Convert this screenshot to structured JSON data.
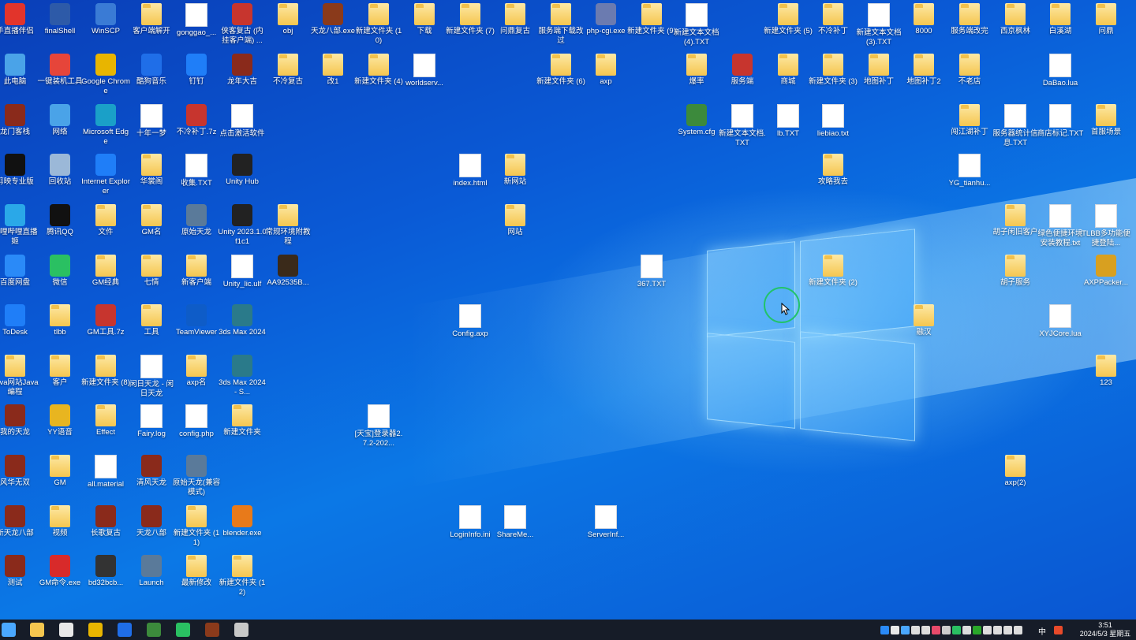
{
  "desktop": {
    "icons": [
      {
        "label": "手直播伴侣",
        "type": "app",
        "color": "#e2342b"
      },
      {
        "label": "finalShell",
        "type": "app",
        "color": "#2d5aa8"
      },
      {
        "label": "WinSCP",
        "type": "app",
        "color": "#3a7bd5"
      },
      {
        "label": "客户端解开",
        "type": "folder"
      },
      {
        "label": "gonggao_...",
        "type": "doc"
      },
      {
        "label": "侠客复古 (内挂客户端) ...",
        "type": "app",
        "color": "#c7352e"
      },
      {
        "label": "obj",
        "type": "folder"
      },
      {
        "label": "天龙八部.exe",
        "type": "app",
        "color": "#8a3a1b"
      },
      {
        "label": "新建文件夹 (10)",
        "type": "folder"
      },
      {
        "label": "下载",
        "type": "folder"
      },
      {
        "label": "新建文件夹 (7)",
        "type": "folder"
      },
      {
        "label": "问鼎复古",
        "type": "folder"
      },
      {
        "label": "服务端下载改过",
        "type": "folder"
      },
      {
        "label": "php-cgi.exe",
        "type": "app",
        "color": "#6b7bb0"
      },
      {
        "label": "新建文件夹 (9)",
        "type": "folder"
      },
      {
        "label": "新建文本文档 (4).TXT",
        "type": "doc"
      },
      {
        "label": "新建文件夹 (5)",
        "type": "folder"
      },
      {
        "label": "不冷补丁",
        "type": "folder"
      },
      {
        "label": "新建文本文档 (3).TXT",
        "type": "doc"
      },
      {
        "label": "8000",
        "type": "folder"
      },
      {
        "label": "服务端改完",
        "type": "folder"
      },
      {
        "label": "西京枫林",
        "type": "folder"
      },
      {
        "label": "白溪湖",
        "type": "folder"
      },
      {
        "label": "问鼎",
        "type": "folder"
      },
      {
        "label": "此电脑",
        "type": "app",
        "color": "#4aa3e8"
      },
      {
        "label": "一键装机工具",
        "type": "app",
        "color": "#e6453a"
      },
      {
        "label": "Google Chrome",
        "type": "app",
        "color": "#e8b500"
      },
      {
        "label": "酷狗音乐",
        "type": "app",
        "color": "#1f6ee8"
      },
      {
        "label": "钉钉",
        "type": "app",
        "color": "#1f7ef8"
      },
      {
        "label": "龙年大吉",
        "type": "app",
        "color": "#8a2a1b"
      },
      {
        "label": "不冷复古",
        "type": "folder"
      },
      {
        "label": "改1",
        "type": "folder"
      },
      {
        "label": "新建文件夹 (4)",
        "type": "folder"
      },
      {
        "label": "worldserv...",
        "type": "doc"
      },
      {
        "label": "新建文件夹 (6)",
        "type": "folder"
      },
      {
        "label": "axp",
        "type": "folder"
      },
      {
        "label": "爆率",
        "type": "folder"
      },
      {
        "label": "服务端",
        "type": "app",
        "color": "#c7352e"
      },
      {
        "label": "商城",
        "type": "folder"
      },
      {
        "label": "新建文件夹 (3)",
        "type": "folder"
      },
      {
        "label": "地图补丁",
        "type": "folder"
      },
      {
        "label": "地图补丁2",
        "type": "folder"
      },
      {
        "label": "不老店",
        "type": "folder"
      },
      {
        "label": "DaBao.lua",
        "type": "doc"
      },
      {
        "label": "龙门客栈",
        "type": "app",
        "color": "#8a2a1b"
      },
      {
        "label": "网络",
        "type": "app",
        "color": "#4aa3e8"
      },
      {
        "label": "Microsoft Edge",
        "type": "app",
        "color": "#1aa0c8"
      },
      {
        "label": "十年一梦",
        "type": "doc"
      },
      {
        "label": "不冷补丁.7z",
        "type": "app",
        "color": "#c7352e"
      },
      {
        "label": "点击激活软件",
        "type": "doc"
      },
      {
        "label": "System.cfg",
        "type": "app",
        "color": "#3c8a3c"
      },
      {
        "label": "新建文本文档.TXT",
        "type": "doc"
      },
      {
        "label": "lb.TXT",
        "type": "doc"
      },
      {
        "label": "liebiao.txt",
        "type": "doc"
      },
      {
        "label": "闯江湖补丁",
        "type": "folder"
      },
      {
        "label": "服务器统计信息.TXT",
        "type": "doc"
      },
      {
        "label": "商店标记.TXT",
        "type": "doc"
      },
      {
        "label": "首服场景",
        "type": "folder"
      },
      {
        "label": "剪映专业版",
        "type": "app",
        "color": "#111111"
      },
      {
        "label": "回收站",
        "type": "app",
        "color": "#9bb8d8"
      },
      {
        "label": "Internet Explorer",
        "type": "app",
        "color": "#1f7ef8"
      },
      {
        "label": "华裳阁",
        "type": "folder"
      },
      {
        "label": "收集.TXT",
        "type": "doc"
      },
      {
        "label": "Unity Hub",
        "type": "app",
        "color": "#222222"
      },
      {
        "label": "index.html",
        "type": "doc"
      },
      {
        "label": "新网站",
        "type": "folder"
      },
      {
        "label": "攻略我去",
        "type": "folder"
      },
      {
        "label": "YG_tianhu...",
        "type": "doc"
      },
      {
        "label": "哔哩哔哩直播姬",
        "type": "app",
        "color": "#2aa8e8"
      },
      {
        "label": "腾讯QQ",
        "type": "app",
        "color": "#111111"
      },
      {
        "label": "文件",
        "type": "folder"
      },
      {
        "label": "GM名",
        "type": "folder"
      },
      {
        "label": "原始天龙",
        "type": "app",
        "color": "#5a7a9a"
      },
      {
        "label": "Unity 2023.1.0f1c1",
        "type": "app",
        "color": "#222222"
      },
      {
        "label": "常规环境附教程",
        "type": "folder"
      },
      {
        "label": "网站",
        "type": "folder"
      },
      {
        "label": "胡子闲旧客户",
        "type": "folder"
      },
      {
        "label": "绿色便捷环境安装教程.txt",
        "type": "doc"
      },
      {
        "label": "TLBB多功能便捷登陆...",
        "type": "doc"
      },
      {
        "label": "百度网盘",
        "type": "app",
        "color": "#2a8af8"
      },
      {
        "label": "微信",
        "type": "app",
        "color": "#2ac062"
      },
      {
        "label": "GM经典",
        "type": "folder"
      },
      {
        "label": "七情",
        "type": "folder"
      },
      {
        "label": "新客户端",
        "type": "folder"
      },
      {
        "label": "Unity_lic.ulf",
        "type": "doc"
      },
      {
        "label": "AA92535B...",
        "type": "app",
        "color": "#3a2a1a"
      },
      {
        "label": "367.TXT",
        "type": "doc"
      },
      {
        "label": "新建文件夹 (2)",
        "type": "folder"
      },
      {
        "label": "胡子服务",
        "type": "folder"
      },
      {
        "label": "AXPPacker...",
        "type": "app",
        "color": "#d8a020"
      },
      {
        "label": "ToDesk",
        "type": "app",
        "color": "#1f7ef8"
      },
      {
        "label": "tlbb",
        "type": "folder"
      },
      {
        "label": "GM工具.7z",
        "type": "app",
        "color": "#c7352e"
      },
      {
        "label": "工具",
        "type": "folder"
      },
      {
        "label": "TeamViewer",
        "type": "app",
        "color": "#0e5cc8"
      },
      {
        "label": "3ds Max 2024",
        "type": "app",
        "color": "#2a7a8a"
      },
      {
        "label": "Config.axp",
        "type": "doc"
      },
      {
        "label": "融汉",
        "type": "folder"
      },
      {
        "label": "XYJCore.lua",
        "type": "doc"
      },
      {
        "label": "Java网站Java编程",
        "type": "folder"
      },
      {
        "label": "客户",
        "type": "folder"
      },
      {
        "label": "新建文件夹 (8)",
        "type": "folder"
      },
      {
        "label": "闲日天龙 - 闲日天龙",
        "type": "doc"
      },
      {
        "label": "axp名",
        "type": "folder"
      },
      {
        "label": "3ds Max 2024 - S...",
        "type": "app",
        "color": "#2a7a8a"
      },
      {
        "label": "123",
        "type": "folder"
      },
      {
        "label": "我的天龙",
        "type": "app",
        "color": "#8a2a1b"
      },
      {
        "label": "YY语音",
        "type": "app",
        "color": "#e8b520"
      },
      {
        "label": "Effect",
        "type": "folder"
      },
      {
        "label": "Fairy.log",
        "type": "doc"
      },
      {
        "label": "config.php",
        "type": "doc"
      },
      {
        "label": "新建文件夹",
        "type": "folder"
      },
      {
        "label": "[天宝]登录器2.7.2-202...",
        "type": "doc"
      },
      {
        "label": "风华无双",
        "type": "app",
        "color": "#8a2a1b"
      },
      {
        "label": "GM",
        "type": "folder"
      },
      {
        "label": "all.material",
        "type": "doc"
      },
      {
        "label": "清风天龙",
        "type": "app",
        "color": "#8a2a1b"
      },
      {
        "label": "原始天龙(兼容模式)",
        "type": "app",
        "color": "#5a7a9a"
      },
      {
        "label": "axp(2)",
        "type": "folder"
      },
      {
        "label": "新天龙八部",
        "type": "app",
        "color": "#8a2a1b"
      },
      {
        "label": "视频",
        "type": "folder"
      },
      {
        "label": "长歌复古",
        "type": "app",
        "color": "#8a2a1b"
      },
      {
        "label": "天龙八部",
        "type": "app",
        "color": "#8a2a1b"
      },
      {
        "label": "新建文件夹 (11)",
        "type": "folder"
      },
      {
        "label": "blender.exe",
        "type": "app",
        "color": "#e87a1a"
      },
      {
        "label": "LoginInfo.ini",
        "type": "doc"
      },
      {
        "label": "ShareMe...",
        "type": "doc"
      },
      {
        "label": "ServerInf...",
        "type": "doc"
      },
      {
        "label": "测试",
        "type": "app",
        "color": "#8a2a1b"
      },
      {
        "label": "GM命令.exe",
        "type": "app",
        "color": "#d82a2a"
      },
      {
        "label": "bd32bcb...",
        "type": "app",
        "color": "#333333"
      },
      {
        "label": "Launch",
        "type": "app",
        "color": "#5a7a9a"
      },
      {
        "label": "最新修改",
        "type": "folder"
      },
      {
        "label": "新建文件夹 (12)",
        "type": "folder"
      }
    ]
  },
  "taskbar": {
    "apps": [
      {
        "name": "start-icon",
        "color": "#4aa8ff"
      },
      {
        "name": "file-explorer-icon",
        "color": "#f5c64f"
      },
      {
        "name": "store-icon",
        "color": "#e8e8e8"
      },
      {
        "name": "chrome-icon",
        "color": "#e8b500"
      },
      {
        "name": "kugou-icon",
        "color": "#1f6ee8"
      },
      {
        "name": "notepad-icon",
        "color": "#3c8a3c"
      },
      {
        "name": "wechat-icon",
        "color": "#2ac062"
      },
      {
        "name": "tianlong-icon",
        "color": "#8a3a1b"
      },
      {
        "name": "remote-desktop-icon",
        "color": "#c8c8c8"
      }
    ],
    "tray_text": {
      "ime": "中",
      "time": "3:51",
      "date": "2024/5/3 星期五"
    }
  }
}
